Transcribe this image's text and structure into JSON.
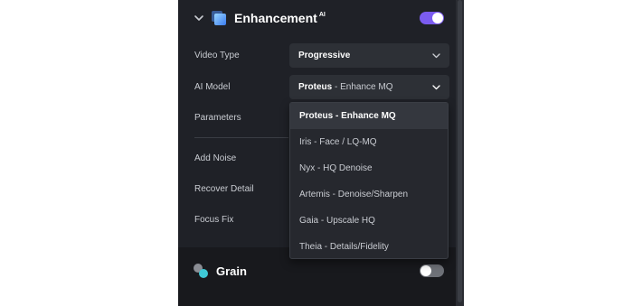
{
  "enhancement": {
    "title": "Enhancement",
    "badge": "AI",
    "enabled": true,
    "icon": "enhancement-cube-icon"
  },
  "video_type": {
    "label": "Video Type",
    "value": "Progressive"
  },
  "ai_model": {
    "label": "AI Model",
    "value_name": "Proteus",
    "value_detail": " - Enhance MQ"
  },
  "rows": {
    "parameters": "Parameters",
    "add_noise": "Add Noise",
    "recover_detail": "Recover Detail",
    "focus_fix": "Focus Fix"
  },
  "dropdown": {
    "options": [
      "Proteus - Enhance MQ",
      "Iris - Face / LQ-MQ",
      "Nyx - HQ Denoise",
      "Artemis - Denoise/Sharpen",
      "Gaia - Upscale HQ",
      "Theia - Details/Fidelity"
    ],
    "selected_index": 0
  },
  "grain": {
    "title": "Grain",
    "enabled": false,
    "icon": "grain-dots-icon"
  },
  "colors": {
    "accent": "#7b5cf0",
    "panel_bg": "#1f2127",
    "select_bg": "#2d3036"
  }
}
